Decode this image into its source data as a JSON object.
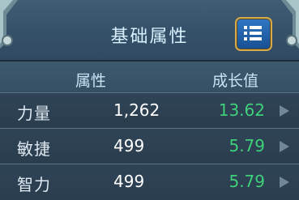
{
  "title": "基础属性",
  "columns": {
    "attribute": "属性",
    "growth": "成长值"
  },
  "rows": [
    {
      "name": "力量",
      "value": "1,262",
      "growth": "13.62"
    },
    {
      "name": "敏捷",
      "value": "499",
      "growth": "5.79"
    },
    {
      "name": "智力",
      "value": "499",
      "growth": "5.79"
    }
  ],
  "icons": {
    "menu": "list-menu-icon",
    "row_arrow": "triangle-right-icon"
  },
  "colors": {
    "growth": "#3fd07a",
    "button": "#2f78c4",
    "button_border": "#d7aa4a"
  }
}
